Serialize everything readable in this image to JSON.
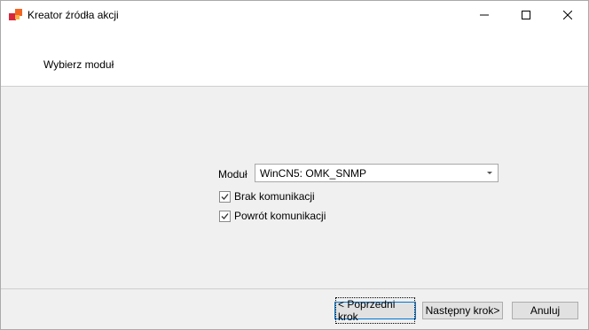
{
  "window": {
    "title": "Kreator źródła akcji",
    "icon": "app-logo-icon",
    "controls": {
      "minimize": "minimize-icon",
      "maximize": "maximize-icon",
      "close": "close-icon"
    }
  },
  "header": {
    "title": "Wybierz moduł"
  },
  "form": {
    "module_label": "Moduł",
    "module_value": "WinCN5: OMK_SNMP",
    "checkboxes": [
      {
        "label": "Brak komunikacji",
        "checked": true
      },
      {
        "label": "Powrót komunikacji",
        "checked": true
      }
    ]
  },
  "footer": {
    "prev_label": "< Poprzedni krok",
    "next_label": "Następny krok>",
    "cancel_label": "Anuluj"
  },
  "colors": {
    "accent": "#0078d7",
    "logo_orange": "#f26522",
    "logo_yellow": "#fbb040",
    "logo_red": "#d7263d"
  }
}
